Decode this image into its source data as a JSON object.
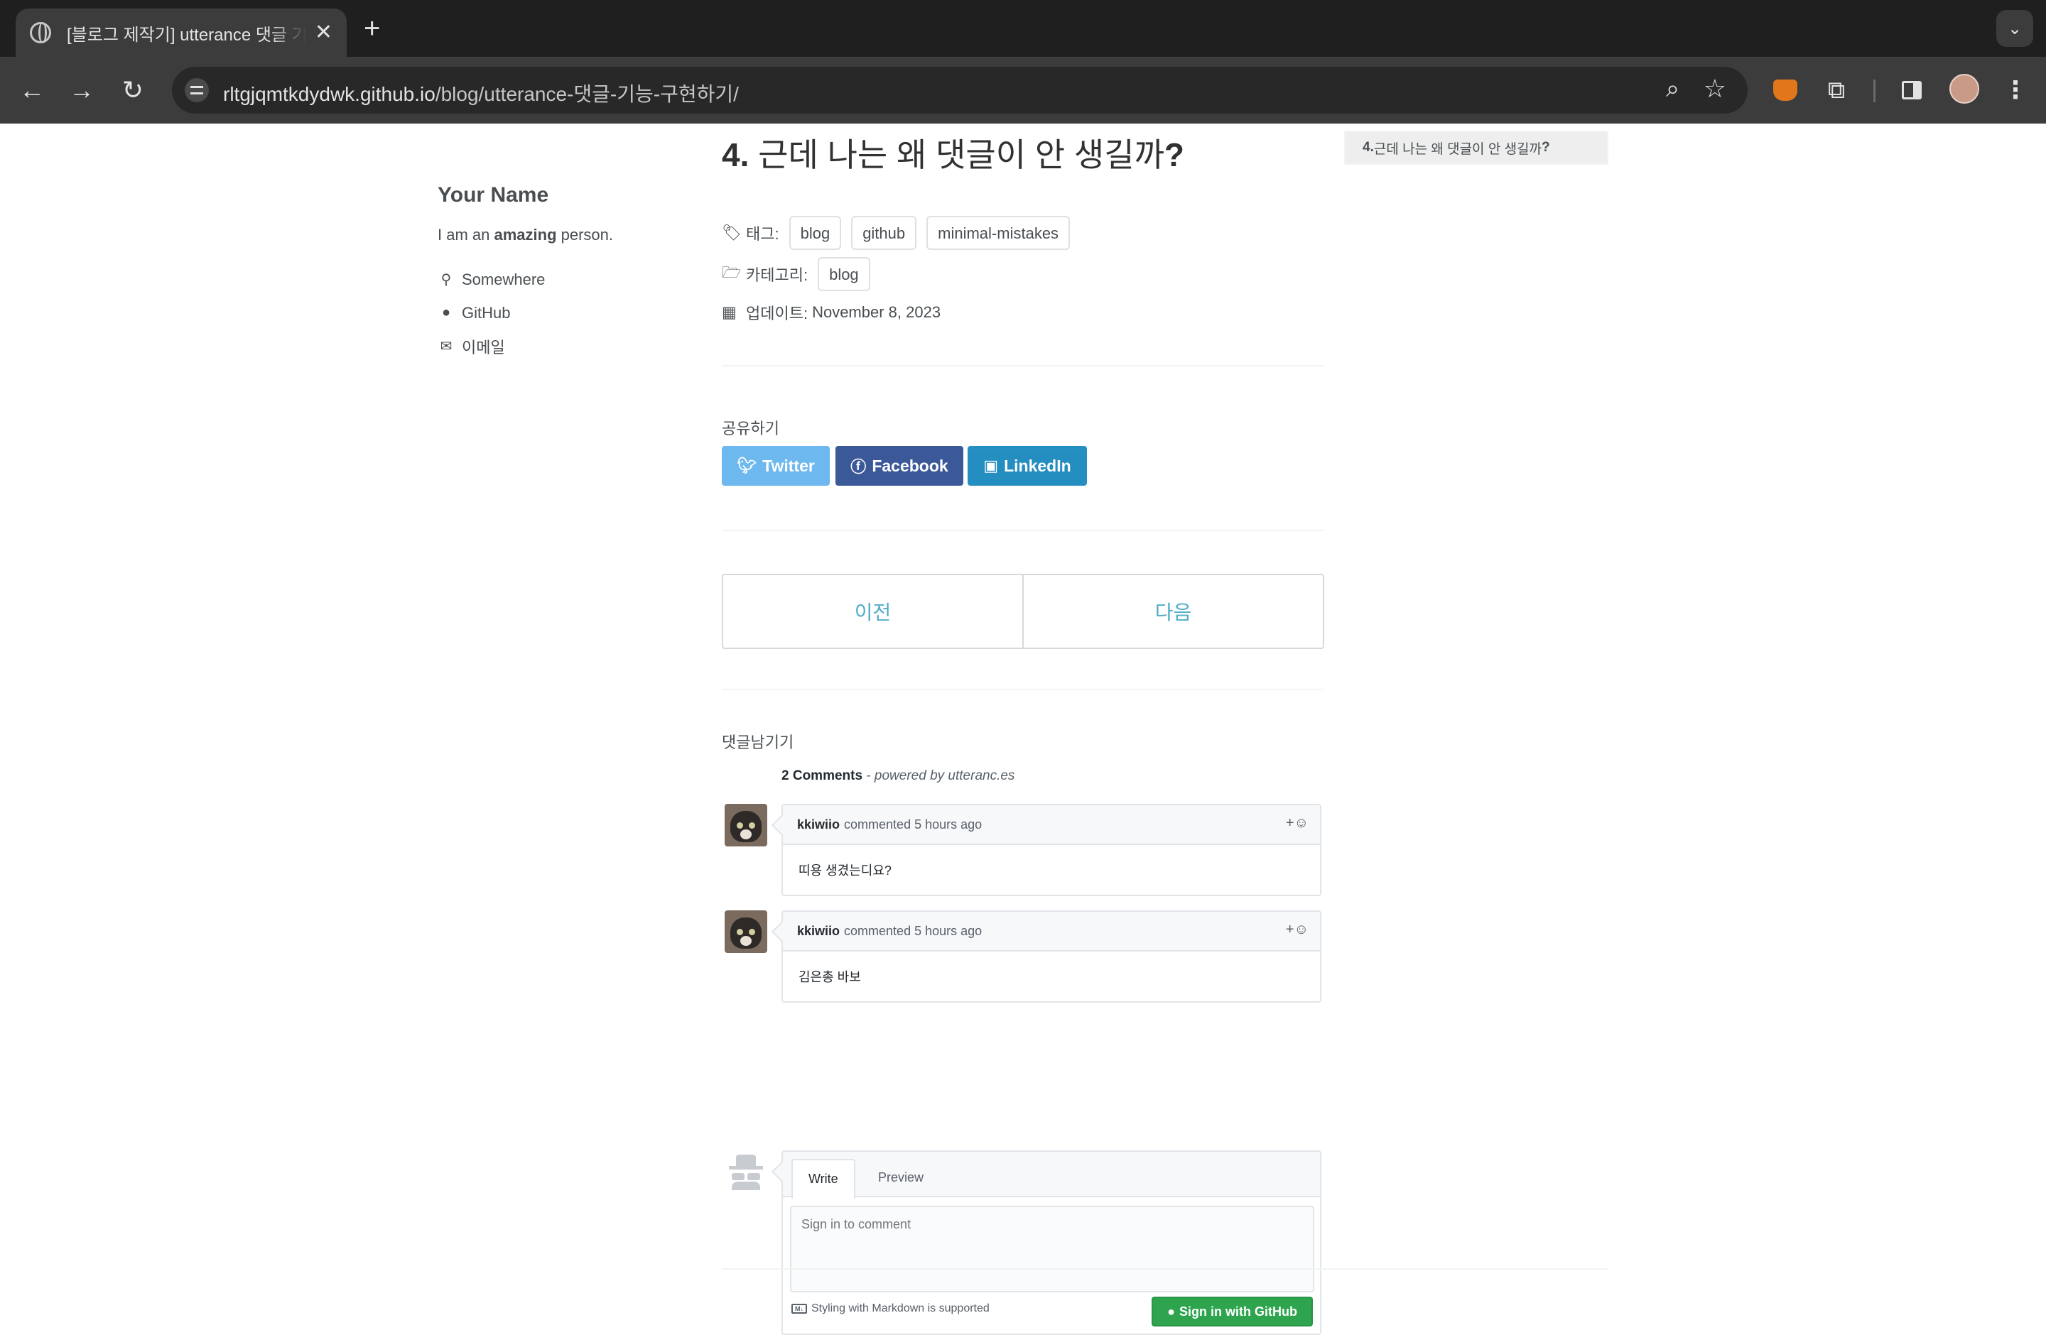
{
  "browser": {
    "tab_title": "[블로그 제작기] utterance 댓글 기능 구현하기",
    "tab_close": "✕",
    "new_tab": "+",
    "tab_search": "⌄",
    "url_host": "rltgjqmtkdydwk.github.io",
    "url_path": "/blog/utterance-댓글-기능-구현하기/",
    "icons": [
      "back-arrow-icon",
      "forward-arrow-icon",
      "reload-icon",
      "site-info-icon",
      "zoom-icon",
      "bookmark-star-icon",
      "metamask-fox-icon",
      "extensions-puzzle-icon",
      "side-panel-icon",
      "profile-avatar-icon",
      "more-menu-icon"
    ]
  },
  "sidebar": {
    "name": "Your Name",
    "bio_prefix": "I am an ",
    "bio_bold": "amazing",
    "bio_suffix": " person.",
    "links": [
      {
        "icon": "map-marker-icon",
        "label": "Somewhere"
      },
      {
        "icon": "github-icon",
        "label": "GitHub"
      },
      {
        "icon": "envelope-icon",
        "label": "이메일"
      }
    ]
  },
  "post": {
    "title_num": "4.",
    "title_text": " 근데 나는 왜 댓글이 안 생길까",
    "title_q": "?",
    "tags_label": "태그:",
    "tags": [
      "blog",
      "github",
      "minimal-mistakes"
    ],
    "categories_label": "카테고리:",
    "categories": [
      "blog"
    ],
    "updated_label": "업데이트:",
    "updated_value": "November 8, 2023"
  },
  "share": {
    "title": "공유하기",
    "buttons": [
      "Twitter",
      "Facebook",
      "LinkedIn"
    ]
  },
  "pager": {
    "prev": "이전",
    "next": "다음"
  },
  "comments": {
    "heading": "댓글남기기",
    "count": "2 Comments",
    "powered_by": " - powered by utteranc.es",
    "items": [
      {
        "author": "kkiwiio",
        "action": "commented 5 hours ago",
        "body": "띠용 생겼는디요?",
        "react": "+☺"
      },
      {
        "author": "kkiwiio",
        "action": "commented 5 hours ago",
        "body": "김은총 바보",
        "react": "+☺"
      }
    ],
    "new_comment": {
      "tab_write": "Write",
      "tab_preview": "Preview",
      "placeholder": "Sign in to comment",
      "markdown_note": "Styling with Markdown is supported",
      "signin_button": "Sign in with GitHub"
    }
  },
  "toc": {
    "num": "4.",
    "text": " 근데 나는 왜 댓글이 안 생길까",
    "q": "?"
  },
  "colors": {
    "twitter": "#55acee",
    "facebook": "#3b5998",
    "linkedin": "#007bb6",
    "link": "#52adc8",
    "github_green": "#2ea44f"
  }
}
